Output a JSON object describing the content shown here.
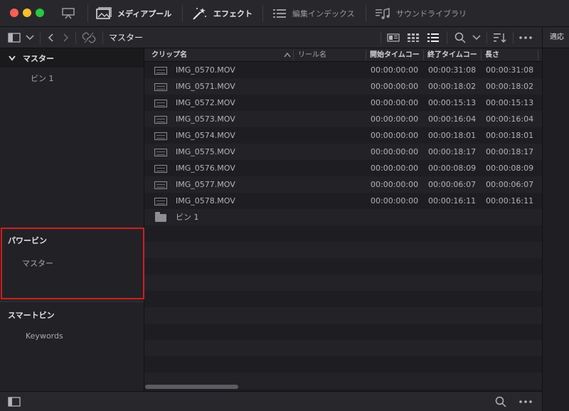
{
  "toolbar": {
    "media_pool_label": "メディアプール",
    "effects_label": "エフェクト",
    "edit_index_label": "編集インデックス",
    "sound_library_label": "サウンドライブラリ"
  },
  "subbar": {
    "current_bin": "マスター"
  },
  "right_panel": {
    "apply_label": "適応"
  },
  "bins": {
    "header": "マスター",
    "items": [
      "ビン 1"
    ]
  },
  "power_bins": {
    "title": "パワービン",
    "items": [
      "マスター"
    ]
  },
  "smart_bins": {
    "title": "スマートビン",
    "items": [
      "Keywords"
    ]
  },
  "table": {
    "columns": [
      "クリップ名",
      "リール名",
      "開始タイムコー",
      "終了タイムコー",
      "長さ"
    ],
    "rows": [
      {
        "name": "IMG_0570.MOV",
        "start": "00:00:00:00",
        "end": "00:00:31:08",
        "duration": "00:00:31:08"
      },
      {
        "name": "IMG_0571.MOV",
        "start": "00:00:00:00",
        "end": "00:00:18:02",
        "duration": "00:00:18:02"
      },
      {
        "name": "IMG_0572.MOV",
        "start": "00:00:00:00",
        "end": "00:00:15:13",
        "duration": "00:00:15:13"
      },
      {
        "name": "IMG_0573.MOV",
        "start": "00:00:00:00",
        "end": "00:00:16:04",
        "duration": "00:00:16:04"
      },
      {
        "name": "IMG_0574.MOV",
        "start": "00:00:00:00",
        "end": "00:00:18:01",
        "duration": "00:00:18:01"
      },
      {
        "name": "IMG_0575.MOV",
        "start": "00:00:00:00",
        "end": "00:00:18:17",
        "duration": "00:00:18:17"
      },
      {
        "name": "IMG_0576.MOV",
        "start": "00:00:00:00",
        "end": "00:00:08:09",
        "duration": "00:00:08:09"
      },
      {
        "name": "IMG_0577.MOV",
        "start": "00:00:00:00",
        "end": "00:00:06:07",
        "duration": "00:00:06:07"
      },
      {
        "name": "IMG_0578.MOV",
        "start": "00:00:00:00",
        "end": "00:00:16:11",
        "duration": "00:00:16:11"
      }
    ],
    "folder_row": {
      "name": "ビン 1"
    }
  },
  "colors": {
    "highlight_border": "#d01e1e",
    "close": "#fe5f57",
    "minimize": "#febc2e",
    "zoom": "#28c840"
  },
  "icons": [
    "monitor-icon",
    "media-pool-icon",
    "effects-wand-icon",
    "list-icon",
    "music-icon",
    "sidebar-toggle-icon",
    "chevron-down-icon",
    "back-icon",
    "forward-icon",
    "link-icon",
    "metadata-view-icon",
    "grid-view-icon",
    "list-view-icon",
    "search-icon",
    "sort-icon",
    "more-icon"
  ]
}
